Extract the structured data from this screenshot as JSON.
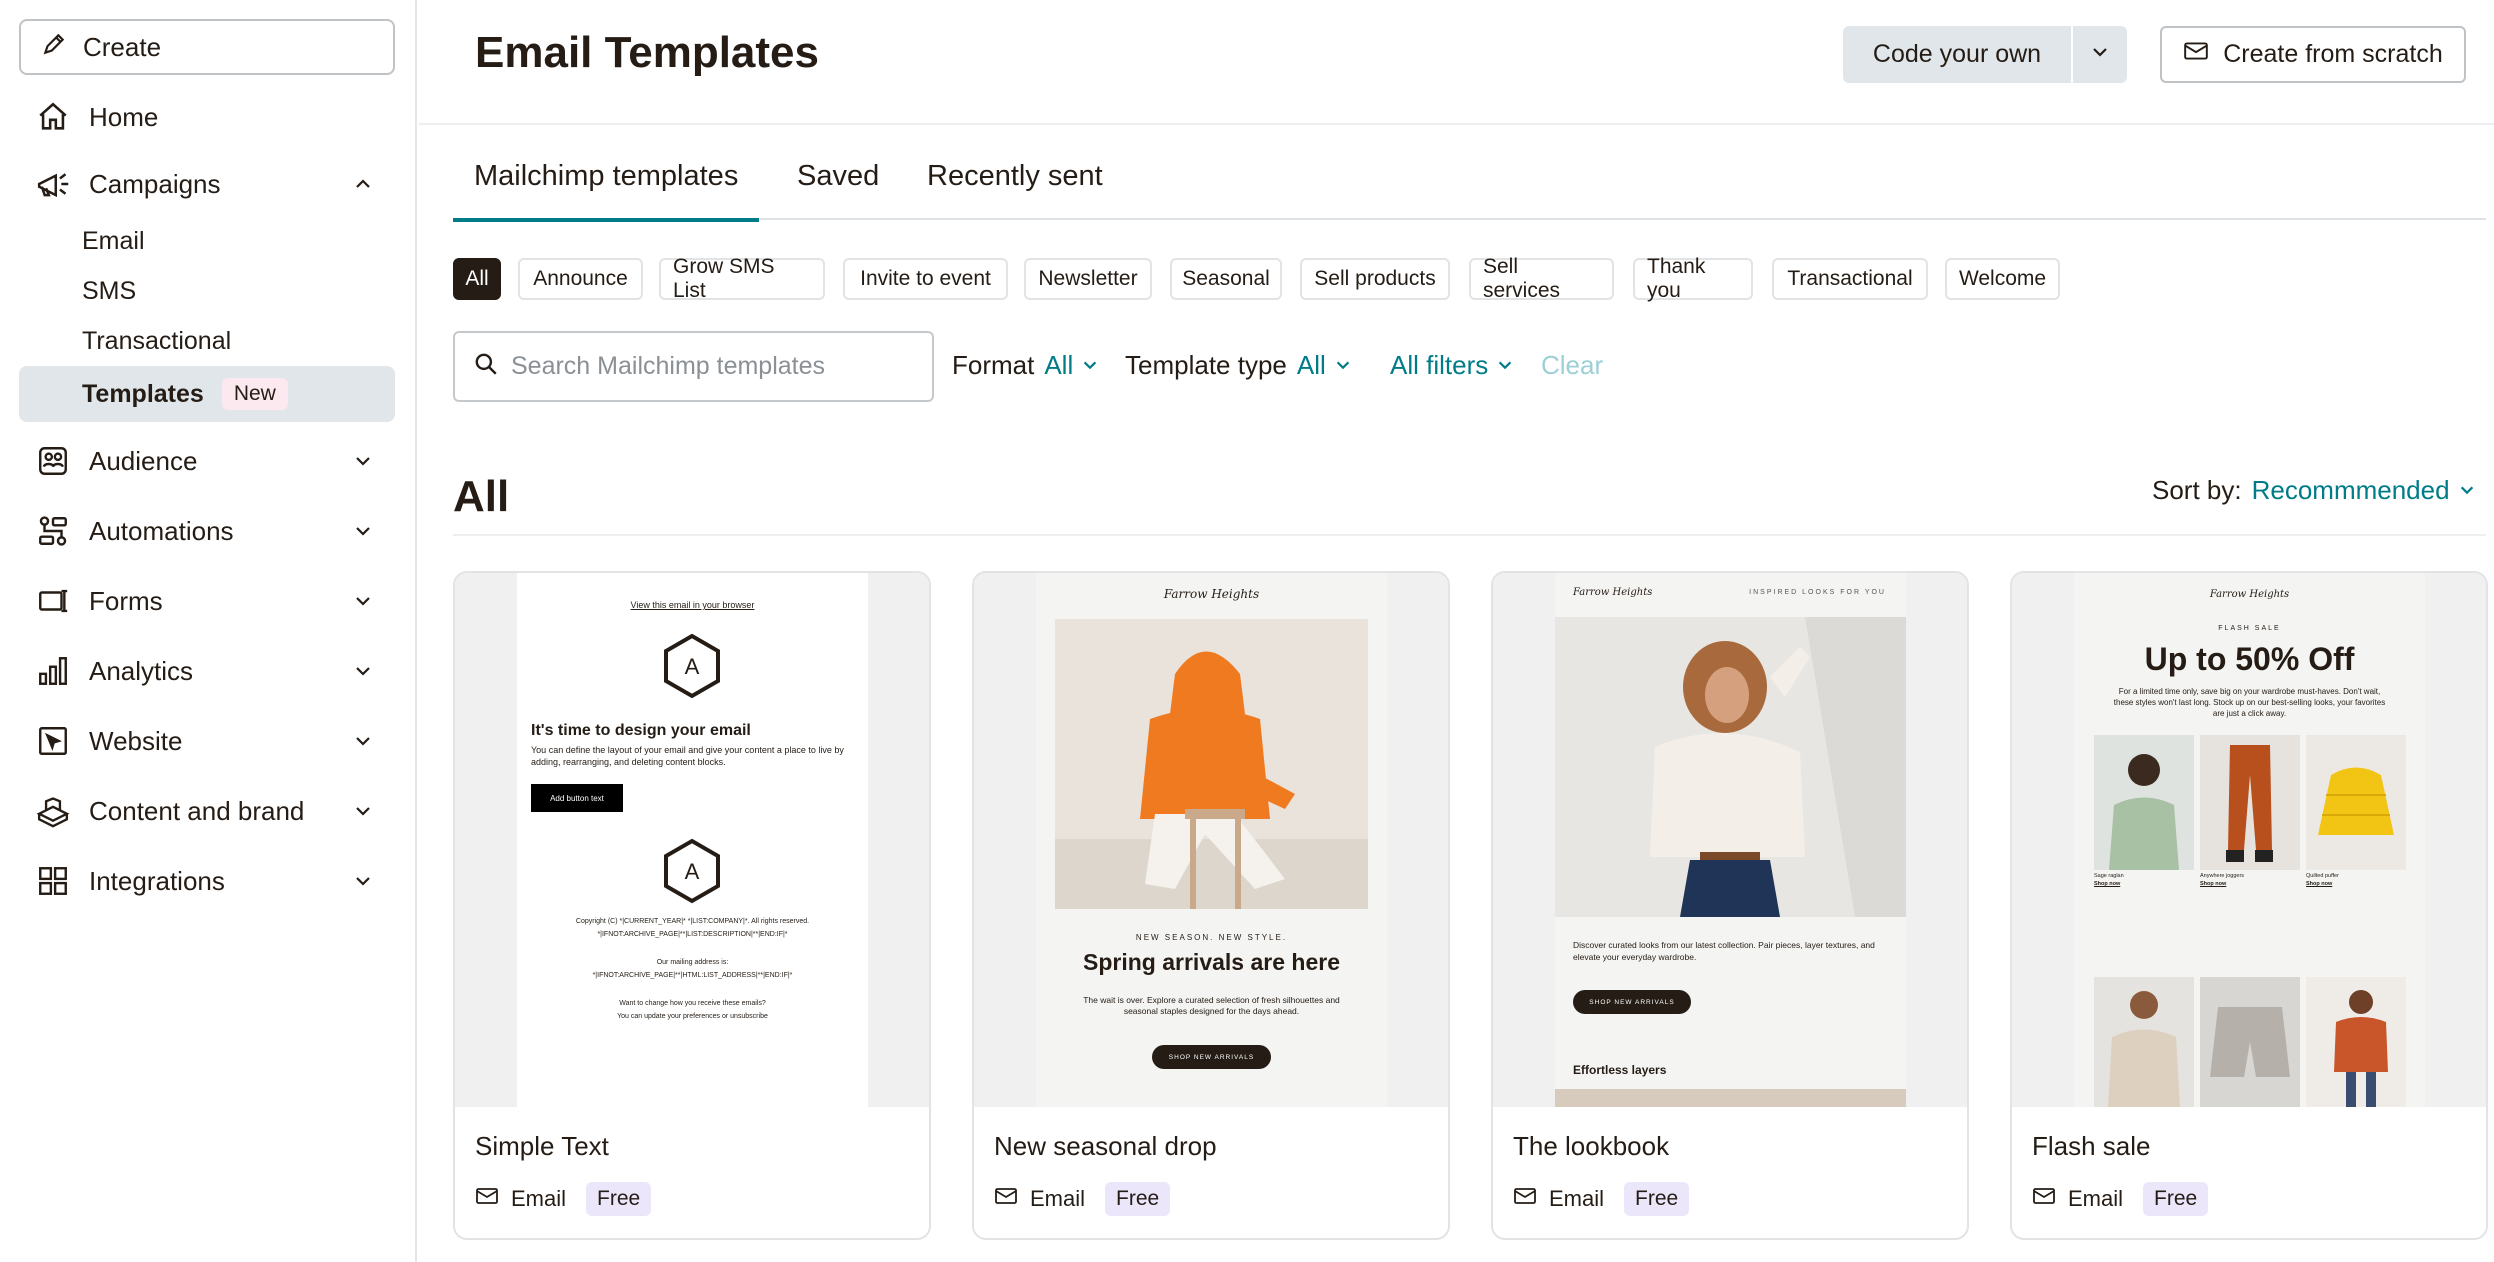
{
  "sidebar": {
    "create_label": "Create",
    "items": [
      {
        "label": "Home",
        "icon": "home-icon"
      },
      {
        "label": "Campaigns",
        "icon": "megaphone-icon"
      },
      {
        "label": "Audience",
        "icon": "audience-icon"
      },
      {
        "label": "Automations",
        "icon": "automations-icon"
      },
      {
        "label": "Forms",
        "icon": "forms-icon"
      },
      {
        "label": "Analytics",
        "icon": "analytics-icon"
      },
      {
        "label": "Website",
        "icon": "website-icon"
      },
      {
        "label": "Content and brand",
        "icon": "content-icon"
      },
      {
        "label": "Integrations",
        "icon": "integrations-icon"
      }
    ],
    "campaign_sub": [
      {
        "label": "Email"
      },
      {
        "label": "SMS"
      },
      {
        "label": "Transactional"
      },
      {
        "label": "Templates",
        "badge": "New"
      }
    ]
  },
  "header": {
    "title": "Email Templates",
    "code_own_label": "Code your own",
    "scratch_label": "Create from scratch"
  },
  "tabs": [
    {
      "label": "Mailchimp templates",
      "active": true
    },
    {
      "label": "Saved"
    },
    {
      "label": "Recently sent"
    }
  ],
  "chips": [
    "All",
    "Announce",
    "Grow SMS List",
    "Invite to event",
    "Newsletter",
    "Seasonal",
    "Sell products",
    "Sell services",
    "Thank you",
    "Transactional",
    "Welcome"
  ],
  "search": {
    "placeholder": "Search Mailchimp templates"
  },
  "filters": {
    "format_label": "Format",
    "format_value": "All",
    "type_label": "Template type",
    "type_value": "All",
    "all_filters": "All filters",
    "clear": "Clear"
  },
  "section": {
    "title": "All",
    "sort_label": "Sort by:",
    "sort_value": "Recommmended"
  },
  "cards": [
    {
      "name": "Simple Text",
      "type": "Email",
      "price": "Free",
      "preview": {
        "link": "View this email in your browser",
        "logo": "A",
        "heading": "It's time to design your email",
        "body": "You can define the layout of your email and give your content a place to live by adding, rearranging, and deleting content blocks.",
        "button": "Add button text",
        "footer1": "Copyright (C) *|CURRENT_YEAR|* *|LIST:COMPANY|*. All rights reserved.",
        "footer2": "*|IFNOT:ARCHIVE_PAGE|**|LIST:DESCRIPTION|**|END:IF|*",
        "footer3": "Our mailing address is:",
        "footer4": "*|IFNOT:ARCHIVE_PAGE|**|HTML:LIST_ADDRESS|**|END:IF|*",
        "footer5": "Want to change how you receive these emails?",
        "footer6": "You can update your preferences or unsubscribe"
      }
    },
    {
      "name": "New seasonal drop",
      "type": "Email",
      "price": "Free",
      "preview": {
        "brand": "Farrow Heights",
        "kicker": "NEW SEASON. NEW STYLE.",
        "heading": "Spring arrivals are here",
        "body": "The wait is over. Explore a curated selection of fresh silhouettes and seasonal staples designed for the days ahead.",
        "button": "SHOP NEW ARRIVALS"
      }
    },
    {
      "name": "The lookbook",
      "type": "Email",
      "price": "Free",
      "preview": {
        "brand": "Farrow Heights",
        "tagline": "INSPIRED LOOKS FOR YOU",
        "body": "Discover curated looks from our latest collection. Pair pieces, layer textures, and elevate your everyday wardrobe.",
        "button": "SHOP NEW ARRIVALS",
        "subheading": "Effortless layers"
      }
    },
    {
      "name": "Flash sale",
      "type": "Email",
      "price": "Free",
      "preview": {
        "brand": "Farrow Heights",
        "kicker": "FLASH SALE",
        "heading": "Up to 50% Off",
        "body": "For a limited time only, save big on your wardrobe must-haves. Don't wait, these styles won't last long. Stock up on our best-selling looks, your favorites are just a click away.",
        "products": [
          {
            "name": "Sage raglan",
            "link": "Shop now"
          },
          {
            "name": "Anywhere joggers",
            "link": "Shop now"
          },
          {
            "name": "Quilted puffer",
            "link": "Shop now"
          }
        ]
      }
    }
  ],
  "colors": {
    "accent": "#007c89",
    "active_nav": "#e0e6e9",
    "chip_active": "#241c15",
    "free_badge": "#ece6fb",
    "new_badge": "#fce8ef"
  }
}
